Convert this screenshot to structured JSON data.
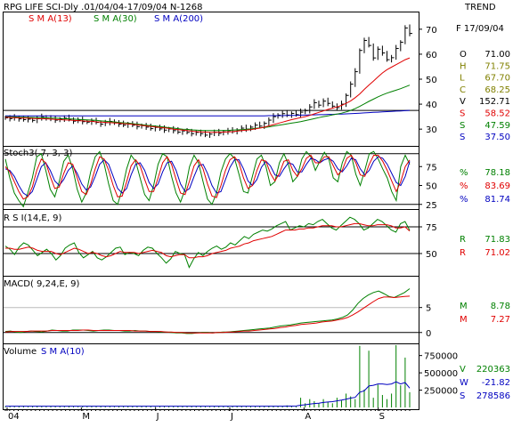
{
  "header": {
    "title": "RPG LIFE SCI-Dly .01/04/04-17/09/04  N-1268",
    "label": "TREND",
    "sma_labels": [
      {
        "text": "S M A(13)",
        "color": "#e00000"
      },
      {
        "text": "S M A(30)",
        "color": "#008000"
      },
      {
        "text": "S M A(200)",
        "color": "#0000c0"
      }
    ]
  },
  "info": {
    "date": "F 17/09/04",
    "rows": [
      {
        "key": "O",
        "value": "71.00",
        "color": "#000000"
      },
      {
        "key": "H",
        "value": "71.75",
        "color": "#808000"
      },
      {
        "key": "L",
        "value": "67.70",
        "color": "#808000"
      },
      {
        "key": "C",
        "value": "68.25",
        "color": "#808000"
      },
      {
        "key": "V",
        "value": "152.71",
        "color": "#000000"
      },
      {
        "key": "S",
        "value": "58.52",
        "color": "#e00000"
      },
      {
        "key": "S",
        "value": "47.59",
        "color": "#008000"
      },
      {
        "key": "S",
        "value": "37.50",
        "color": "#0000c0"
      }
    ]
  },
  "stoch": {
    "title": "Stoch3( 7, 3, 3)",
    "readouts": [
      {
        "key": "%",
        "value": "78.18",
        "color": "#008000"
      },
      {
        "key": "%",
        "value": "83.69",
        "color": "#e00000"
      },
      {
        "key": "%",
        "value": "81.74",
        "color": "#0000c0"
      }
    ]
  },
  "rsi": {
    "title": "R S I(14,E, 9)",
    "readouts": [
      {
        "key": "R",
        "value": "71.83",
        "color": "#008000"
      },
      {
        "key": "R",
        "value": "71.02",
        "color": "#e00000"
      }
    ]
  },
  "macd": {
    "title": "MACD( 9,24,E, 9)",
    "readouts": [
      {
        "key": "M",
        "value": "8.78",
        "color": "#008000"
      },
      {
        "key": "M",
        "value": "7.27",
        "color": "#e00000"
      }
    ]
  },
  "volume": {
    "title": "Volume",
    "sma_label": "S M A(10)",
    "readouts": [
      {
        "key": "V",
        "value": "220363",
        "color": "#008000"
      },
      {
        "key": "W",
        "value": "-21.82",
        "color": "#0000c0"
      },
      {
        "key": "S",
        "value": "278586",
        "color": "#0000c0"
      }
    ]
  },
  "colors": {
    "price": "#000000",
    "sma13": "#e00000",
    "sma30": "#008000",
    "sma200": "#0000c0",
    "k": "#008000",
    "d": "#e00000",
    "slow": "#0000c0",
    "vol": "#008000",
    "volsma": "#0000c0"
  },
  "chart_data": [
    {
      "type": "ohlc",
      "panel": "price",
      "x_labels": [
        "04",
        "M",
        "J",
        "J",
        "A",
        "S"
      ],
      "ylim": [
        24,
        76
      ],
      "y_ticks": [
        30,
        40,
        50,
        60,
        70
      ],
      "reference_line": 37.5,
      "close": [
        34.5,
        34.2,
        34.6,
        34.1,
        33.8,
        34.0,
        33.5,
        34.2,
        34.8,
        34.5,
        34.0,
        33.6,
        34.0,
        34.4,
        33.9,
        33.2,
        33.6,
        33.0,
        32.8,
        33.2,
        32.7,
        32.0,
        32.6,
        33.1,
        32.5,
        32.0,
        31.6,
        32.1,
        31.6,
        31.0,
        31.4,
        30.8,
        30.2,
        30.7,
        30.1,
        29.6,
        30.1,
        29.4,
        28.8,
        29.3,
        28.7,
        28.2,
        28.7,
        28.2,
        27.6,
        28.0,
        28.7,
        28.3,
        28.9,
        29.4,
        29.0,
        29.6,
        30.4,
        30.0,
        30.8,
        31.6,
        31.2,
        32.3,
        33.6,
        35.0,
        35.6,
        36.2,
        35.6,
        36.3,
        35.8,
        36.8,
        37.4,
        38.9,
        40.6,
        39.6,
        41.2,
        40.3,
        39.2,
        38.6,
        40.0,
        43.5,
        48.0,
        53.0,
        61.5,
        65.5,
        63.5,
        58.5,
        62.0,
        60.5,
        57.8,
        58.6,
        62.3,
        64.8,
        70.5,
        68.3
      ],
      "sma13": [
        34.8,
        34.7,
        34.6,
        34.5,
        34.4,
        34.4,
        34.3,
        34.2,
        34.2,
        34.1,
        34.0,
        33.9,
        33.8,
        33.7,
        33.6,
        33.5,
        33.4,
        33.3,
        33.2,
        33.1,
        32.9,
        32.8,
        32.7,
        32.6,
        32.5,
        32.4,
        32.2,
        32.1,
        31.9,
        31.7,
        31.5,
        31.3,
        31.1,
        30.9,
        30.7,
        30.5,
        30.3,
        30.0,
        29.8,
        29.6,
        29.4,
        29.2,
        29.0,
        28.9,
        28.8,
        28.7,
        28.7,
        28.7,
        28.8,
        28.9,
        29.0,
        29.2,
        29.4,
        29.6,
        29.8,
        30.1,
        30.4,
        30.8,
        31.3,
        31.8,
        32.3,
        32.8,
        33.3,
        33.8,
        34.2,
        34.6,
        35.0,
        35.5,
        36.1,
        36.7,
        37.3,
        37.9,
        38.4,
        38.9,
        39.5,
        40.3,
        41.3,
        42.6,
        44.1,
        45.9,
        47.6,
        49.2,
        50.9,
        52.5,
        53.8,
        54.8,
        55.8,
        56.8,
        57.8,
        58.5
      ],
      "sma30": [
        35.0,
        34.9,
        34.9,
        34.8,
        34.8,
        34.7,
        34.7,
        34.6,
        34.6,
        34.5,
        34.4,
        34.4,
        34.3,
        34.2,
        34.1,
        34.0,
        33.9,
        33.8,
        33.7,
        33.6,
        33.5,
        33.3,
        33.2,
        33.0,
        32.9,
        32.7,
        32.5,
        32.4,
        32.2,
        32.0,
        31.8,
        31.6,
        31.4,
        31.2,
        31.0,
        30.8,
        30.6,
        30.4,
        30.2,
        30.0,
        29.9,
        29.7,
        29.6,
        29.5,
        29.4,
        29.4,
        29.4,
        29.4,
        29.5,
        29.5,
        29.6,
        29.7,
        29.8,
        29.9,
        30.1,
        30.3,
        30.5,
        30.7,
        30.9,
        31.2,
        31.5,
        31.8,
        32.1,
        32.4,
        32.7,
        33.0,
        33.4,
        33.8,
        34.2,
        34.6,
        35.0,
        35.3,
        35.7,
        36.0,
        36.4,
        36.9,
        37.5,
        38.2,
        39.1,
        40.1,
        41.1,
        42.0,
        42.9,
        43.7,
        44.4,
        45.0,
        45.6,
        46.2,
        46.9,
        47.6
      ],
      "sma200": [
        35.3,
        35.3,
        35.3,
        35.3,
        35.3,
        35.3,
        35.3,
        35.3,
        35.3,
        35.3,
        35.3,
        35.3,
        35.3,
        35.3,
        35.3,
        35.3,
        35.3,
        35.3,
        35.3,
        35.3,
        35.3,
        35.3,
        35.3,
        35.3,
        35.3,
        35.3,
        35.3,
        35.3,
        35.3,
        35.3,
        35.3,
        35.3,
        35.3,
        35.3,
        35.3,
        35.3,
        35.3,
        35.3,
        35.3,
        35.3,
        35.3,
        35.3,
        35.3,
        35.3,
        35.3,
        35.3,
        35.3,
        35.3,
        35.3,
        35.3,
        35.3,
        35.3,
        35.3,
        35.3,
        35.3,
        35.3,
        35.3,
        35.3,
        35.4,
        35.4,
        35.4,
        35.4,
        35.5,
        35.5,
        35.5,
        35.6,
        35.6,
        35.7,
        35.7,
        35.8,
        35.8,
        35.9,
        35.9,
        36.0,
        36.0,
        36.1,
        36.2,
        36.3,
        36.4,
        36.5,
        36.6,
        36.7,
        36.8,
        36.9,
        37.0,
        37.1,
        37.2,
        37.3,
        37.4,
        37.5
      ]
    },
    {
      "type": "line",
      "panel": "stochastic",
      "ylim": [
        20,
        100
      ],
      "y_ticks": [
        25,
        50,
        75
      ],
      "reference_lines": [
        25,
        92
      ],
      "k": [
        85,
        60,
        40,
        30,
        22,
        40,
        60,
        88,
        92,
        70,
        45,
        35,
        55,
        82,
        90,
        72,
        45,
        28,
        40,
        68,
        88,
        95,
        78,
        52,
        30,
        25,
        45,
        72,
        90,
        82,
        60,
        38,
        30,
        50,
        78,
        92,
        88,
        62,
        40,
        28,
        45,
        75,
        90,
        80,
        55,
        32,
        25,
        40,
        68,
        85,
        92,
        86,
        65,
        42,
        40,
        62,
        85,
        90,
        75,
        50,
        55,
        80,
        92,
        78,
        55,
        62,
        85,
        95,
        88,
        70,
        82,
        94,
        85,
        60,
        55,
        80,
        95,
        90,
        65,
        50,
        70,
        92,
        95,
        85,
        72,
        60,
        42,
        30,
        75,
        90,
        78
      ],
      "d": [
        75,
        68,
        55,
        42,
        32,
        35,
        48,
        70,
        85,
        80,
        62,
        46,
        48,
        66,
        80,
        78,
        60,
        42,
        38,
        52,
        72,
        88,
        85,
        70,
        50,
        35,
        36,
        55,
        76,
        84,
        76,
        58,
        42,
        42,
        60,
        80,
        88,
        78,
        58,
        40,
        38,
        56,
        76,
        84,
        72,
        52,
        36,
        34,
        50,
        70,
        84,
        88,
        80,
        60,
        46,
        50,
        70,
        84,
        82,
        66,
        56,
        66,
        82,
        84,
        70,
        62,
        72,
        86,
        90,
        80,
        80,
        88,
        88,
        76,
        64,
        70,
        86,
        90,
        80,
        64,
        62,
        78,
        90,
        90,
        82,
        70,
        56,
        42,
        55,
        75,
        83.69
      ],
      "slow": [
        72,
        70,
        62,
        50,
        40,
        36,
        42,
        58,
        75,
        80,
        70,
        56,
        50,
        58,
        70,
        76,
        66,
        52,
        44,
        48,
        62,
        78,
        84,
        78,
        62,
        46,
        40,
        46,
        64,
        78,
        80,
        70,
        54,
        46,
        52,
        68,
        80,
        82,
        70,
        52,
        42,
        46,
        62,
        76,
        78,
        66,
        50,
        40,
        42,
        58,
        74,
        84,
        84,
        72,
        56,
        50,
        58,
        74,
        82,
        76,
        64,
        62,
        72,
        80,
        78,
        68,
        68,
        78,
        86,
        84,
        80,
        84,
        86,
        82,
        72,
        68,
        76,
        86,
        84,
        72,
        64,
        70,
        82,
        88,
        86,
        78,
        66,
        54,
        50,
        62,
        81.74
      ]
    },
    {
      "type": "line",
      "panel": "rsi",
      "ylim": [
        30,
        90
      ],
      "y_ticks": [
        50,
        75
      ],
      "reference_lines": [
        50,
        75
      ],
      "rsi": [
        57,
        54,
        49,
        56,
        60,
        58,
        53,
        48,
        51,
        54,
        50,
        44,
        48,
        55,
        58,
        60,
        51,
        46,
        49,
        52,
        46,
        44,
        47,
        51,
        55,
        56,
        49,
        51,
        50,
        48,
        53,
        56,
        55,
        50,
        46,
        41,
        45,
        52,
        50,
        49,
        37,
        45,
        51,
        48,
        52,
        55,
        57,
        54,
        56,
        60,
        58,
        62,
        66,
        64,
        68,
        70,
        72,
        71,
        73,
        76,
        78,
        80,
        72,
        74,
        76,
        75,
        78,
        77,
        80,
        82,
        78,
        74,
        72,
        76,
        80,
        84,
        82,
        78,
        72,
        74,
        78,
        82,
        80,
        76,
        72,
        70,
        78,
        80,
        71.83
      ],
      "signal": [
        55,
        55,
        54,
        54,
        55,
        56,
        55,
        53,
        52,
        52,
        52,
        50,
        49,
        51,
        53,
        55,
        54,
        52,
        50,
        51,
        50,
        48,
        47,
        48,
        50,
        52,
        51,
        51,
        51,
        50,
        51,
        52,
        53,
        52,
        51,
        48,
        47,
        48,
        49,
        49,
        46,
        46,
        47,
        47,
        48,
        50,
        51,
        52,
        53,
        55,
        56,
        57,
        59,
        60,
        62,
        63,
        64,
        65,
        66,
        68,
        70,
        72,
        72,
        72,
        73,
        73,
        74,
        74,
        75,
        76,
        76,
        76,
        75,
        75,
        76,
        77,
        78,
        78,
        77,
        76,
        76,
        77,
        77,
        77,
        76,
        74,
        74,
        75,
        71.02
      ]
    },
    {
      "type": "line",
      "panel": "macd",
      "ylim": [
        -2,
        11
      ],
      "y_ticks": [
        0,
        5
      ],
      "reference_lines": [
        0,
        5
      ],
      "macd": [
        0.2,
        0.3,
        0.1,
        0.0,
        0.2,
        0.3,
        0.2,
        0.1,
        0.3,
        0.5,
        0.4,
        0.3,
        0.3,
        0.5,
        0.5,
        0.5,
        0.4,
        0.3,
        0.4,
        0.5,
        0.5,
        0.4,
        0.4,
        0.3,
        0.3,
        0.4,
        0.3,
        0.3,
        0.2,
        0.2,
        0.1,
        0.1,
        0.0,
        -0.1,
        -0.1,
        -0.2,
        -0.2,
        -0.1,
        0.0,
        0.0,
        -0.1,
        0.0,
        0.1,
        0.1,
        0.2,
        0.3,
        0.4,
        0.5,
        0.6,
        0.7,
        0.8,
        0.9,
        1.1,
        1.3,
        1.4,
        1.5,
        1.7,
        1.9,
        2.0,
        2.1,
        2.2,
        2.3,
        2.4,
        2.5,
        2.7,
        3.0,
        3.5,
        4.5,
        5.8,
        6.8,
        7.5,
        8.0,
        8.3,
        7.8,
        7.2,
        7.0,
        7.5,
        8.0,
        8.78
      ],
      "signal": [
        0.1,
        0.2,
        0.2,
        0.2,
        0.2,
        0.3,
        0.3,
        0.3,
        0.3,
        0.4,
        0.4,
        0.4,
        0.4,
        0.4,
        0.4,
        0.5,
        0.5,
        0.4,
        0.4,
        0.4,
        0.4,
        0.4,
        0.4,
        0.4,
        0.4,
        0.3,
        0.3,
        0.3,
        0.2,
        0.2,
        0.2,
        0.1,
        0.1,
        0.0,
        0.0,
        -0.1,
        -0.1,
        -0.1,
        -0.1,
        -0.1,
        -0.1,
        0.0,
        0.0,
        0.1,
        0.1,
        0.2,
        0.3,
        0.3,
        0.4,
        0.5,
        0.6,
        0.7,
        0.8,
        1.0,
        1.1,
        1.3,
        1.4,
        1.6,
        1.7,
        1.8,
        1.9,
        2.1,
        2.2,
        2.3,
        2.5,
        2.7,
        3.0,
        3.5,
        4.1,
        4.8,
        5.5,
        6.2,
        6.8,
        7.1,
        7.1,
        7.0,
        7.1,
        7.2,
        7.27
      ]
    },
    {
      "type": "bar",
      "panel": "volume",
      "ylim": [
        0,
        900000
      ],
      "y_ticks": [
        250000,
        500000,
        750000
      ],
      "volume": [
        15000,
        20000,
        12000,
        18000,
        25000,
        10000,
        14000,
        22000,
        16000,
        12000,
        18000,
        20000,
        15000,
        12000,
        24000,
        18000,
        10000,
        15000,
        12000,
        20000,
        14000,
        16000,
        18000,
        12000,
        10000,
        15000,
        20000,
        14000,
        16000,
        12000,
        18000,
        22000,
        15000,
        10000,
        14000,
        16000,
        12000,
        18000,
        20000,
        15000,
        12000,
        14000,
        16000,
        18000,
        12000,
        10000,
        15000,
        20000,
        14000,
        16000,
        18000,
        22000,
        15000,
        12000,
        14000,
        16000,
        18000,
        20000,
        25000,
        22000,
        18000,
        16000,
        30000,
        20000,
        15000,
        140000,
        60000,
        120000,
        90000,
        60000,
        120000,
        80000,
        60000,
        140000,
        100000,
        200000,
        160000,
        120000,
        890000,
        260000,
        820000,
        140000,
        330000,
        180000,
        120000,
        200000,
        900000,
        320000,
        720000,
        220363
      ],
      "sma10": [
        18000,
        18000,
        18000,
        18000,
        18000,
        18000,
        18000,
        18000,
        18000,
        18000,
        18000,
        18000,
        18000,
        18000,
        18000,
        18000,
        18000,
        18000,
        18000,
        18000,
        18000,
        18000,
        18000,
        18000,
        18000,
        18000,
        18000,
        18000,
        18000,
        18000,
        18000,
        18000,
        18000,
        18000,
        18000,
        18000,
        18000,
        18000,
        18000,
        18000,
        18000,
        18000,
        18000,
        18000,
        18000,
        18000,
        18000,
        18000,
        18000,
        18000,
        18000,
        18000,
        18000,
        18000,
        18000,
        18000,
        18000,
        18000,
        18000,
        18000,
        18000,
        18000,
        19000,
        19000,
        20000,
        32000,
        38000,
        49000,
        57000,
        62000,
        72000,
        78000,
        83000,
        95000,
        105000,
        120000,
        135000,
        145000,
        220000,
        240000,
        310000,
        320000,
        340000,
        340000,
        330000,
        340000,
        370000,
        340000,
        360000,
        278586
      ]
    }
  ]
}
